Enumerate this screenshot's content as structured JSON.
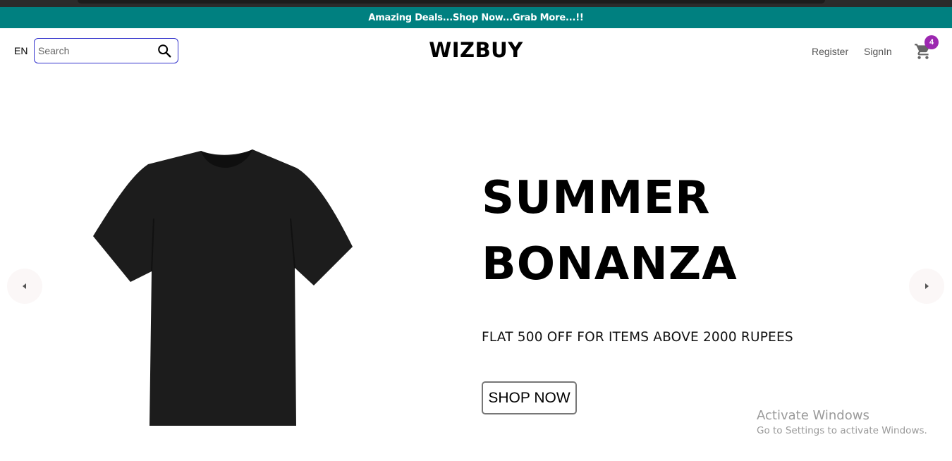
{
  "announcement": "Amazing Deals...Shop Now...Grab More...!!",
  "header": {
    "language": "EN",
    "search": {
      "placeholder": "Search",
      "value": ""
    },
    "logo": "WIZBUY",
    "links": {
      "register": "Register",
      "signin": "SignIn"
    },
    "cart": {
      "count": "4",
      "icon": "shopping-cart-icon"
    }
  },
  "slider": {
    "headline_line1": "SUMMER",
    "headline_line2": "BONANZA",
    "description": "FLAT 500 OFF FOR ITEMS ABOVE 2000 RUPEES",
    "button_label": "SHOP NOW",
    "image": "black-tshirt"
  },
  "watermark": {
    "title": "Activate Windows",
    "subtitle": "Go to Settings to activate Windows."
  },
  "colors": {
    "announcement_bg": "#008080",
    "badge": "#9c27b0",
    "search_border": "#3333cc"
  }
}
